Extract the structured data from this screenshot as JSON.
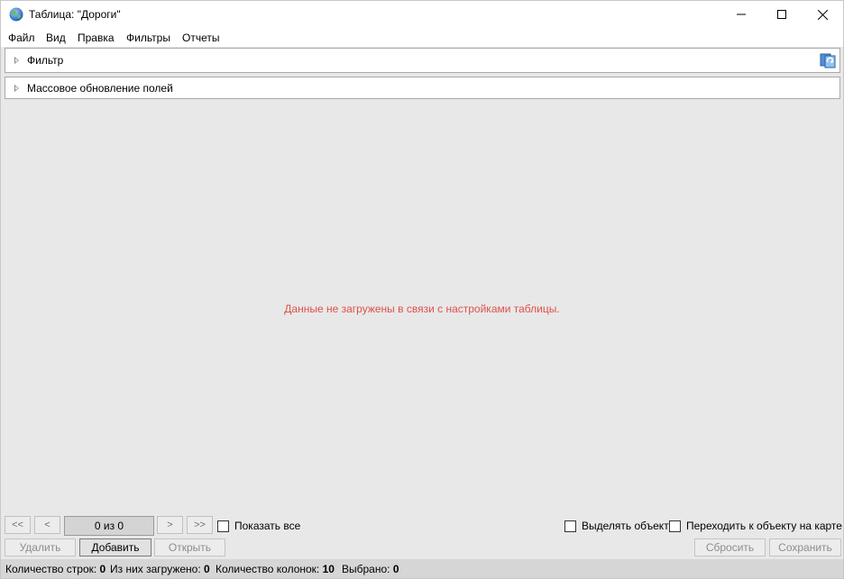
{
  "window": {
    "title": "Таблица: \"Дороги\"",
    "icon": "globe-icon"
  },
  "menu": {
    "items": [
      {
        "label": "Файл"
      },
      {
        "label": "Вид"
      },
      {
        "label": "Правка"
      },
      {
        "label": "Фильтры"
      },
      {
        "label": "Отчеты"
      }
    ]
  },
  "panels": {
    "filter_label": "Фильтр",
    "mass_update_label": "Массовое обновление полей"
  },
  "message": "Данные не загружены в связи с настройками таблицы.",
  "message_color": "#e0504a",
  "navigation": {
    "first": "<<",
    "prev": "<",
    "page_indicator": "0 из 0",
    "next": ">",
    "last": ">>",
    "show_all_label": "Показать все",
    "show_all_checked": false,
    "select_object_label": "Выделять объект",
    "select_object_checked": false,
    "goto_object_label": "Переходить к объекту на карте",
    "goto_object_checked": false
  },
  "actions": {
    "delete": "Удалить",
    "add": "Добавить",
    "open": "Открыть",
    "reset": "Сбросить",
    "save": "Сохранить"
  },
  "status": {
    "rows_label": "Количество строк:",
    "rows_value": "0",
    "loaded_label": "Из них загружено:",
    "loaded_value": "0",
    "columns_label": "Количество колонок:",
    "columns_value": "10",
    "selected_label": "Выбрано:",
    "selected_value": "0"
  }
}
